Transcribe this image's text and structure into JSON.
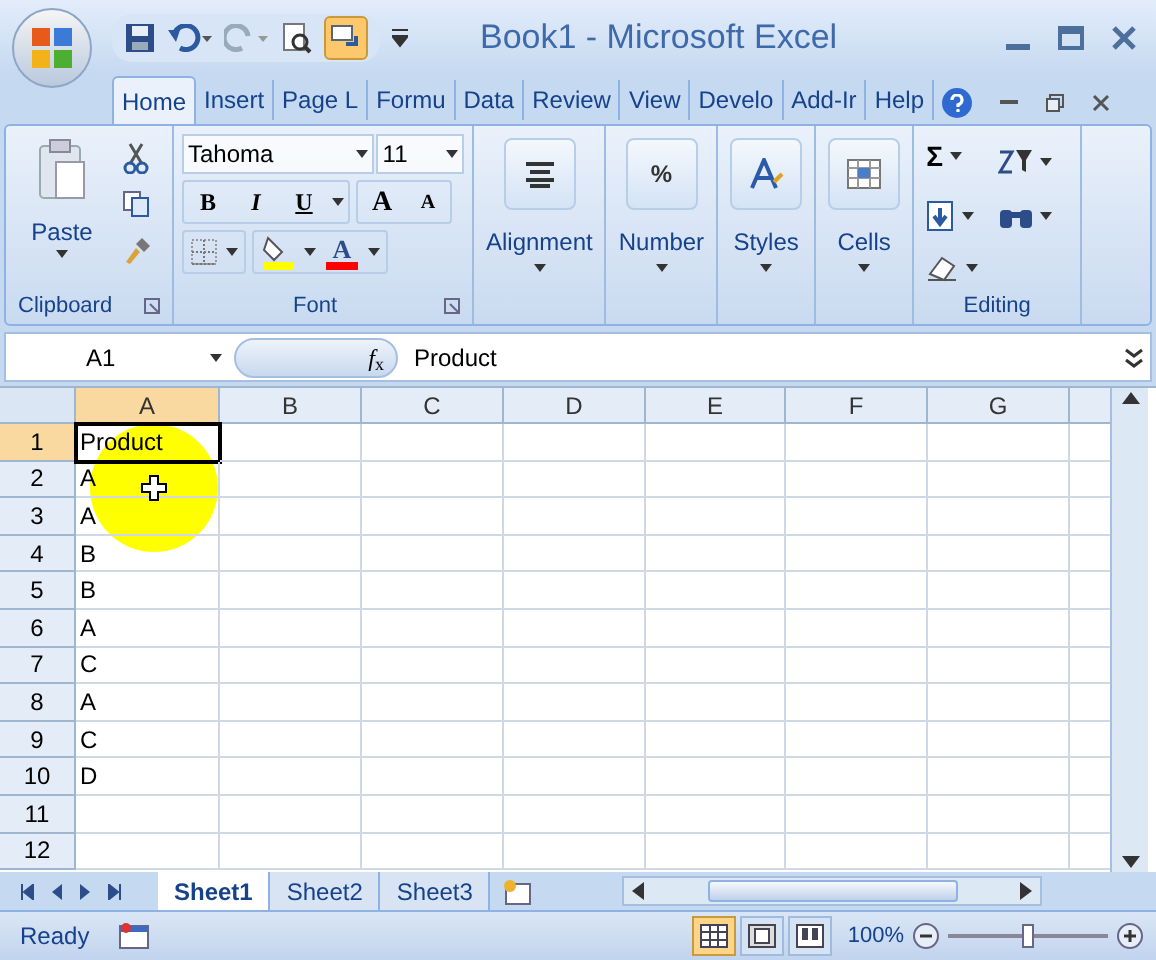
{
  "window": {
    "title": "Book1 - Microsoft Excel"
  },
  "ribbon_tabs": [
    {
      "label": "Home",
      "selected": true
    },
    {
      "label": "Insert",
      "selected": false
    },
    {
      "label": "Page L",
      "selected": false
    },
    {
      "label": "Formu",
      "selected": false
    },
    {
      "label": "Data",
      "selected": false
    },
    {
      "label": "Review",
      "selected": false
    },
    {
      "label": "View",
      "selected": false
    },
    {
      "label": "Develo",
      "selected": false
    },
    {
      "label": "Add-Ir",
      "selected": false
    },
    {
      "label": "Help",
      "selected": false
    }
  ],
  "clipboard": {
    "group_label": "Clipboard",
    "paste": "Paste"
  },
  "font": {
    "group_label": "Font",
    "font_name": "Tahoma",
    "font_size": "11",
    "bold": "B",
    "italic": "I",
    "underline": "U",
    "grow": "A",
    "shrink": "A",
    "font_color": "A"
  },
  "big_groups": [
    {
      "label": "Alignment",
      "kind": "alignment"
    },
    {
      "label": "Number",
      "kind": "number",
      "glyph": "%"
    },
    {
      "label": "Styles",
      "kind": "styles"
    },
    {
      "label": "Cells",
      "kind": "cells"
    }
  ],
  "editing": {
    "group_label": "Editing",
    "sum": "Σ"
  },
  "formula_bar": {
    "name_box": "A1",
    "fx": "*f*$_{x}$",
    "value": "Product"
  },
  "columns": [
    {
      "label": "A",
      "selected": true
    },
    {
      "label": "B",
      "selected": false
    },
    {
      "label": "C",
      "selected": false
    },
    {
      "label": "D",
      "selected": false
    },
    {
      "label": "E",
      "selected": false
    },
    {
      "label": "F",
      "selected": false
    },
    {
      "label": "G",
      "selected": false
    }
  ],
  "rows": [
    {
      "number": "1",
      "value": "Product",
      "selected": true
    },
    {
      "number": "2",
      "value": "A",
      "selected": false
    },
    {
      "number": "3",
      "value": "A",
      "selected": false
    },
    {
      "number": "4",
      "value": "B",
      "selected": false
    },
    {
      "number": "5",
      "value": "B",
      "selected": false
    },
    {
      "number": "6",
      "value": "A",
      "selected": false
    },
    {
      "number": "7",
      "value": "C",
      "selected": false
    },
    {
      "number": "8",
      "value": "A",
      "selected": false
    },
    {
      "number": "9",
      "value": "C",
      "selected": false
    },
    {
      "number": "10",
      "value": "D",
      "selected": false
    },
    {
      "number": "11",
      "selected": false
    },
    {
      "number": "12",
      "selected": false
    }
  ],
  "sheets": [
    {
      "label": "Sheet1",
      "selected": true
    },
    {
      "label": "Sheet2",
      "selected": false
    },
    {
      "label": "Sheet3",
      "selected": false
    }
  ],
  "status_bar": {
    "status": "Ready",
    "zoom": "100%",
    "views": [
      {
        "kind": "normal",
        "selected": true
      },
      {
        "kind": "page_layout",
        "selected": false
      },
      {
        "kind": "page_break",
        "selected": false
      }
    ],
    "zoom_slider": {
      "level": 0.5
    }
  }
}
